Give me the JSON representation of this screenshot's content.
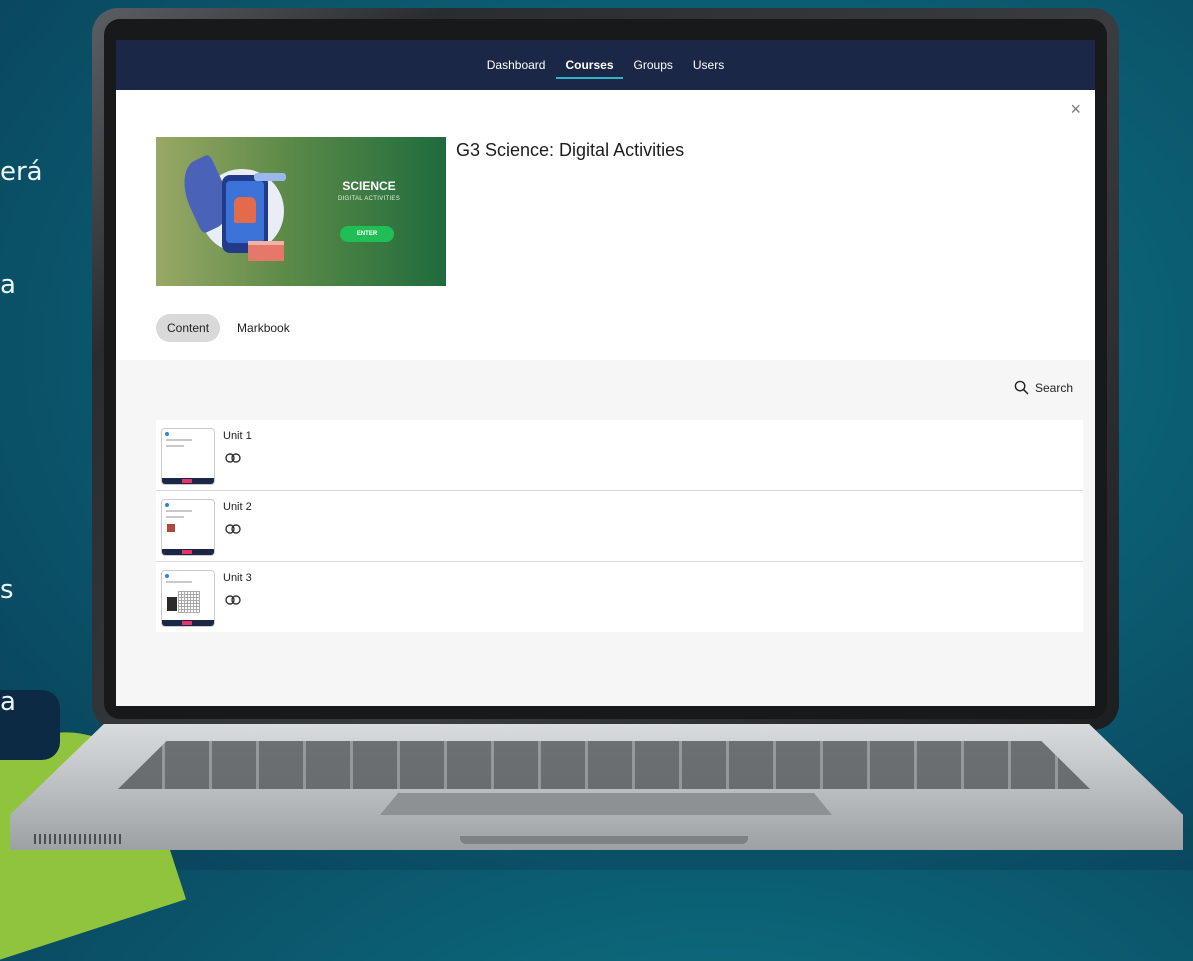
{
  "background": {
    "side_text": [
      "erá",
      "a",
      "s",
      "a"
    ],
    "accent_color": "#0b5f73"
  },
  "nav": {
    "items": [
      {
        "label": "Dashboard",
        "active": false
      },
      {
        "label": "Courses",
        "active": true
      },
      {
        "label": "Groups",
        "active": false
      },
      {
        "label": "Users",
        "active": false
      }
    ],
    "bg_color": "#1b2746",
    "active_underline_color": "#2fb3c7"
  },
  "header": {
    "close_icon": "close-icon",
    "close_glyph": "×",
    "course_title": "G3 Science: Digital Activities",
    "banner": {
      "title": "SCIENCE",
      "subtitle": "DIGITAL ACTIVITIES",
      "button": "ENTER"
    }
  },
  "tabs": [
    {
      "label": "Content",
      "active": true
    },
    {
      "label": "Markbook",
      "active": false
    }
  ],
  "content": {
    "search_label": "Search",
    "search_icon": "search-icon",
    "units": [
      {
        "name": "Unit 1",
        "icon": "link-icon"
      },
      {
        "name": "Unit 2",
        "icon": "link-icon"
      },
      {
        "name": "Unit 3",
        "icon": "link-icon"
      }
    ]
  }
}
